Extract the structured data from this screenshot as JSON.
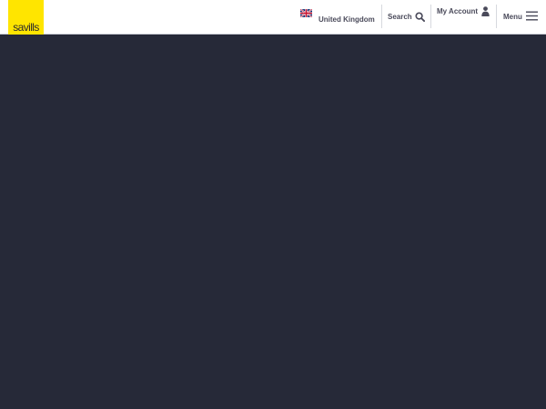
{
  "brand": {
    "logo_text": "savills",
    "logo_color": "#ffe500"
  },
  "header": {
    "country": {
      "label": "United Kingdom",
      "flag_icon": "uk-flag-icon"
    },
    "search": {
      "label": "Search",
      "icon": "search-icon"
    },
    "account": {
      "label": "My Account",
      "icon": "user-icon"
    },
    "menu": {
      "label": "Menu",
      "icon": "hamburger-menu-icon"
    }
  },
  "colors": {
    "header_bg": "#ffffff",
    "page_bg": "#262938",
    "text": "#4a4a5a"
  }
}
